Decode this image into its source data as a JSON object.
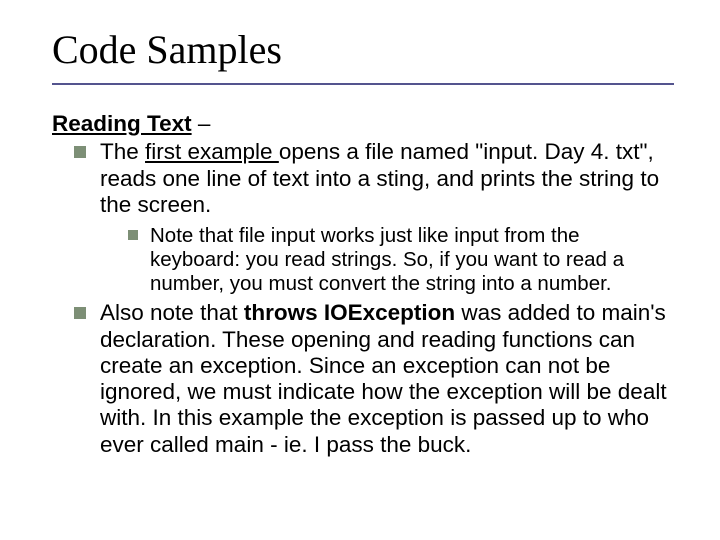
{
  "title": "Code Samples",
  "subhead": "Reading Text",
  "subhead_suffix": " –",
  "bullets": {
    "b1_pre": "The ",
    "b1_link": "first example ",
    "b1_post": "opens a file named \"input. Day 4. txt\", reads one line of text into a sting, and prints the string to the screen.",
    "b1_sub": "Note that file input works just like input from the keyboard: you read strings. So, if you want to read a number, you must convert the string into a number.",
    "b2_pre": "Also note that ",
    "b2_bold": "throws IOException",
    "b2_post": " was added to main's declaration. These opening and reading functions can create an exception. Since an exception can not be ignored, we must indicate how the exception will be dealt with. In this example the exception is passed up to who ever called main - ie. I pass the buck."
  }
}
